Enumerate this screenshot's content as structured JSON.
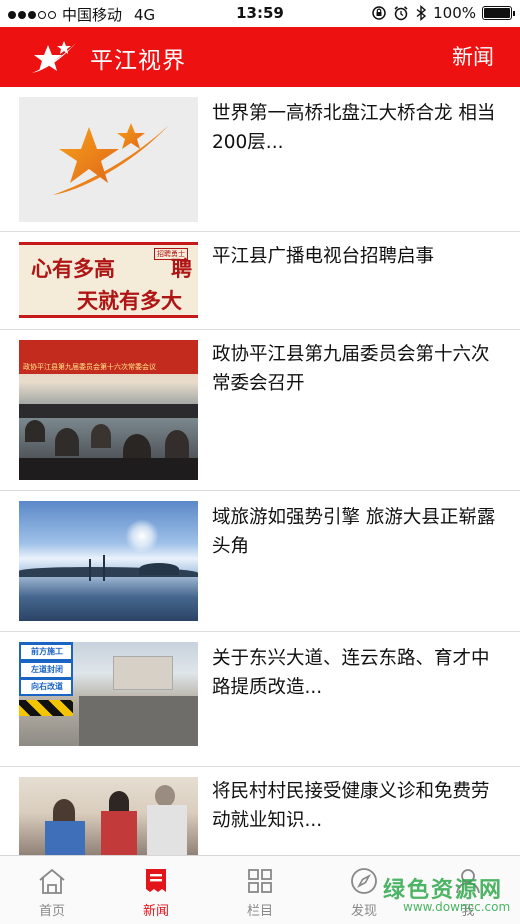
{
  "status_bar": {
    "carrier": "中国移动",
    "network": "4G",
    "time": "13:59",
    "battery": "100%",
    "battery_level": 1.0
  },
  "header": {
    "app_title": "平江视界",
    "section": "新闻"
  },
  "news": [
    {
      "title": "世界第一高桥北盘江大桥合龙 相当200层..."
    },
    {
      "title": "平江县广播电视台招聘启事",
      "thumb_text_1": "心有多高",
      "thumb_text_2": "天就有多大",
      "thumb_text_3": "聘",
      "thumb_badge": "招聘勇士"
    },
    {
      "title": "政协平江县第九届委员会第十六次常委会召开",
      "thumb_banner": "政协平江县第九届委员会第十六次常委会议"
    },
    {
      "title": "域旅游如强势引擎 旅游大县正崭露头角"
    },
    {
      "title": "关于东兴大道、连云东路、育才中路提质改造...",
      "sign_1": "前方施工",
      "sign_2": "左道封闭",
      "sign_3": "向右改道"
    },
    {
      "title": "将民村村民接受健康义诊和免费劳动就业知识..."
    }
  ],
  "tabs": [
    {
      "label": "首页",
      "icon": "home-icon"
    },
    {
      "label": "新闻",
      "icon": "news-icon"
    },
    {
      "label": "栏目",
      "icon": "grid-icon"
    },
    {
      "label": "发现",
      "icon": "compass-icon"
    },
    {
      "label": "我",
      "icon": "user-icon"
    }
  ],
  "watermark": {
    "text": "绿色资源网",
    "url": "www.downcc.com"
  },
  "colors": {
    "brand_red": "#ee1111",
    "tab_active": "#e4141b",
    "tab_inactive": "#888888"
  }
}
